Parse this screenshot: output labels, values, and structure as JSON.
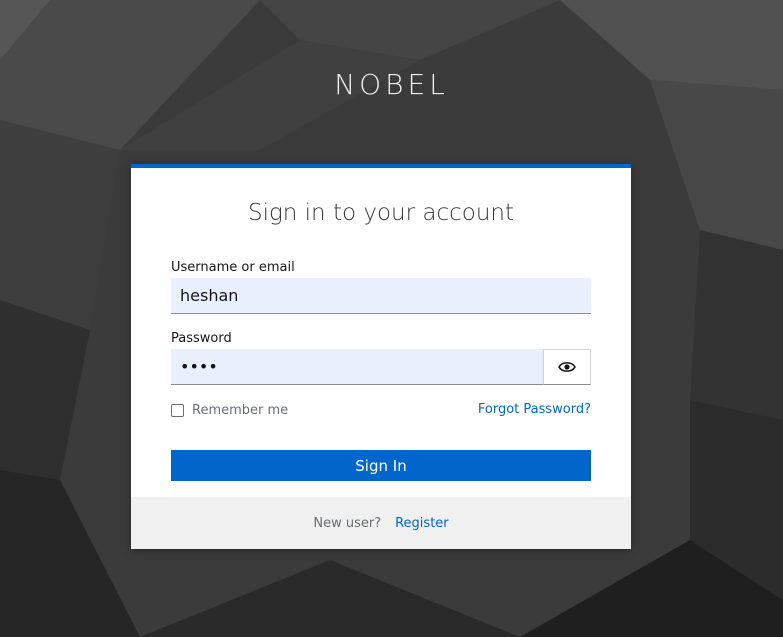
{
  "brand": {
    "title": "NOBEL"
  },
  "login": {
    "heading": "Sign in to your account",
    "username_label": "Username or email",
    "username_value": "heshan",
    "password_label": "Password",
    "password_value": "••••",
    "remember_label": "Remember me",
    "remember_checked": false,
    "forgot_label": "Forgot Password?",
    "signin_label": "Sign In",
    "show_password_icon": "eye-icon"
  },
  "footer": {
    "new_user_text": "New user?",
    "register_label": "Register"
  },
  "colors": {
    "accent": "#0066cc",
    "input_bg": "#e8f0fe",
    "footer_bg": "#f0f0f0",
    "page_bg": "#3a3a3a"
  }
}
